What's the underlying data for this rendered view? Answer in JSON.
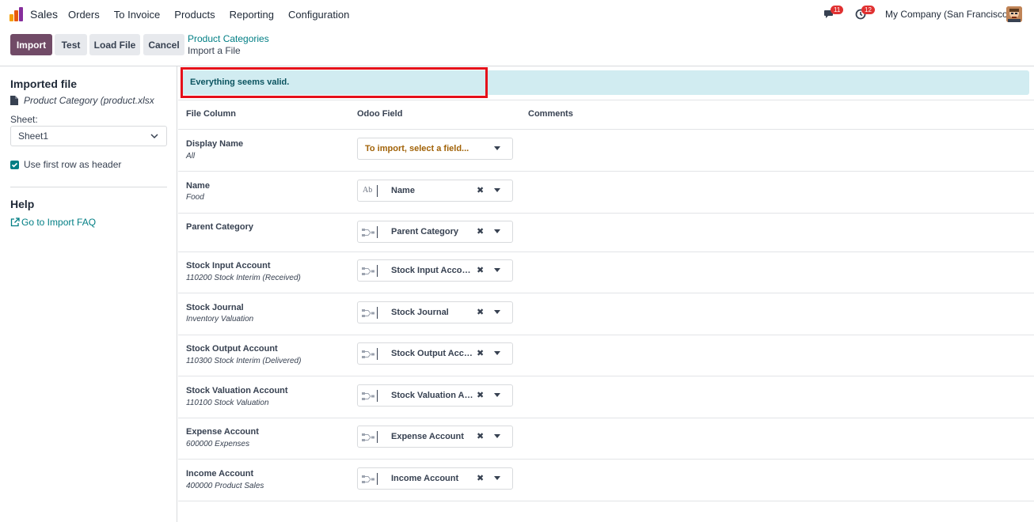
{
  "nav": {
    "app_name": "Sales",
    "menu": [
      "Orders",
      "To Invoice",
      "Products",
      "Reporting",
      "Configuration"
    ],
    "messages_badge": "11",
    "activities_badge": "12",
    "company": "My Company (San Francisco)"
  },
  "toolbar": {
    "import_label": "Import",
    "test_label": "Test",
    "load_file_label": "Load File",
    "cancel_label": "Cancel"
  },
  "breadcrumb": {
    "parent": "Product Categories",
    "current": "Import a File"
  },
  "sidebar": {
    "imported_file_title": "Imported file",
    "file_name": "Product Category (product.xlsx",
    "sheet_label": "Sheet:",
    "sheet_value": "Sheet1",
    "header_checkbox_label": "Use first row as header",
    "header_checked": true,
    "help_title": "Help",
    "faq_link": "Go to Import FAQ"
  },
  "alert": {
    "message": "Everything seems valid."
  },
  "table": {
    "headers": {
      "file_column": "File Column",
      "odoo_field": "Odoo Field",
      "comments": "Comments"
    },
    "rows": [
      {
        "name": "Display Name",
        "sample": "All",
        "field": "",
        "placeholder": "To import, select a field...",
        "icon": "none"
      },
      {
        "name": "Name",
        "sample": "Food",
        "field": "Name",
        "icon": "text-field-icon"
      },
      {
        "name": "Parent Category",
        "sample": "",
        "field": "Parent Category",
        "icon": "relation-icon"
      },
      {
        "name": "Stock Input Account",
        "sample": "110200 Stock Interim (Received)",
        "field": "Stock Input Account",
        "icon": "relation-icon"
      },
      {
        "name": "Stock Journal",
        "sample": "Inventory Valuation",
        "field": "Stock Journal",
        "icon": "relation-icon"
      },
      {
        "name": "Stock Output Account",
        "sample": "110300 Stock Interim (Delivered)",
        "field": "Stock Output Account",
        "icon": "relation-icon"
      },
      {
        "name": "Stock Valuation Account",
        "sample": "110100 Stock Valuation",
        "field": "Stock Valuation Account",
        "icon": "relation-icon"
      },
      {
        "name": "Expense Account",
        "sample": "600000 Expenses",
        "field": "Expense Account",
        "icon": "relation-icon"
      },
      {
        "name": "Income Account",
        "sample": "400000 Product Sales",
        "field": "Income Account",
        "icon": "relation-icon"
      }
    ]
  },
  "colors": {
    "primary": "#714b67",
    "link": "#017e84",
    "alert_bg": "#d1ecf1",
    "alert_text": "#0c5460",
    "highlight": "#e5101a"
  }
}
